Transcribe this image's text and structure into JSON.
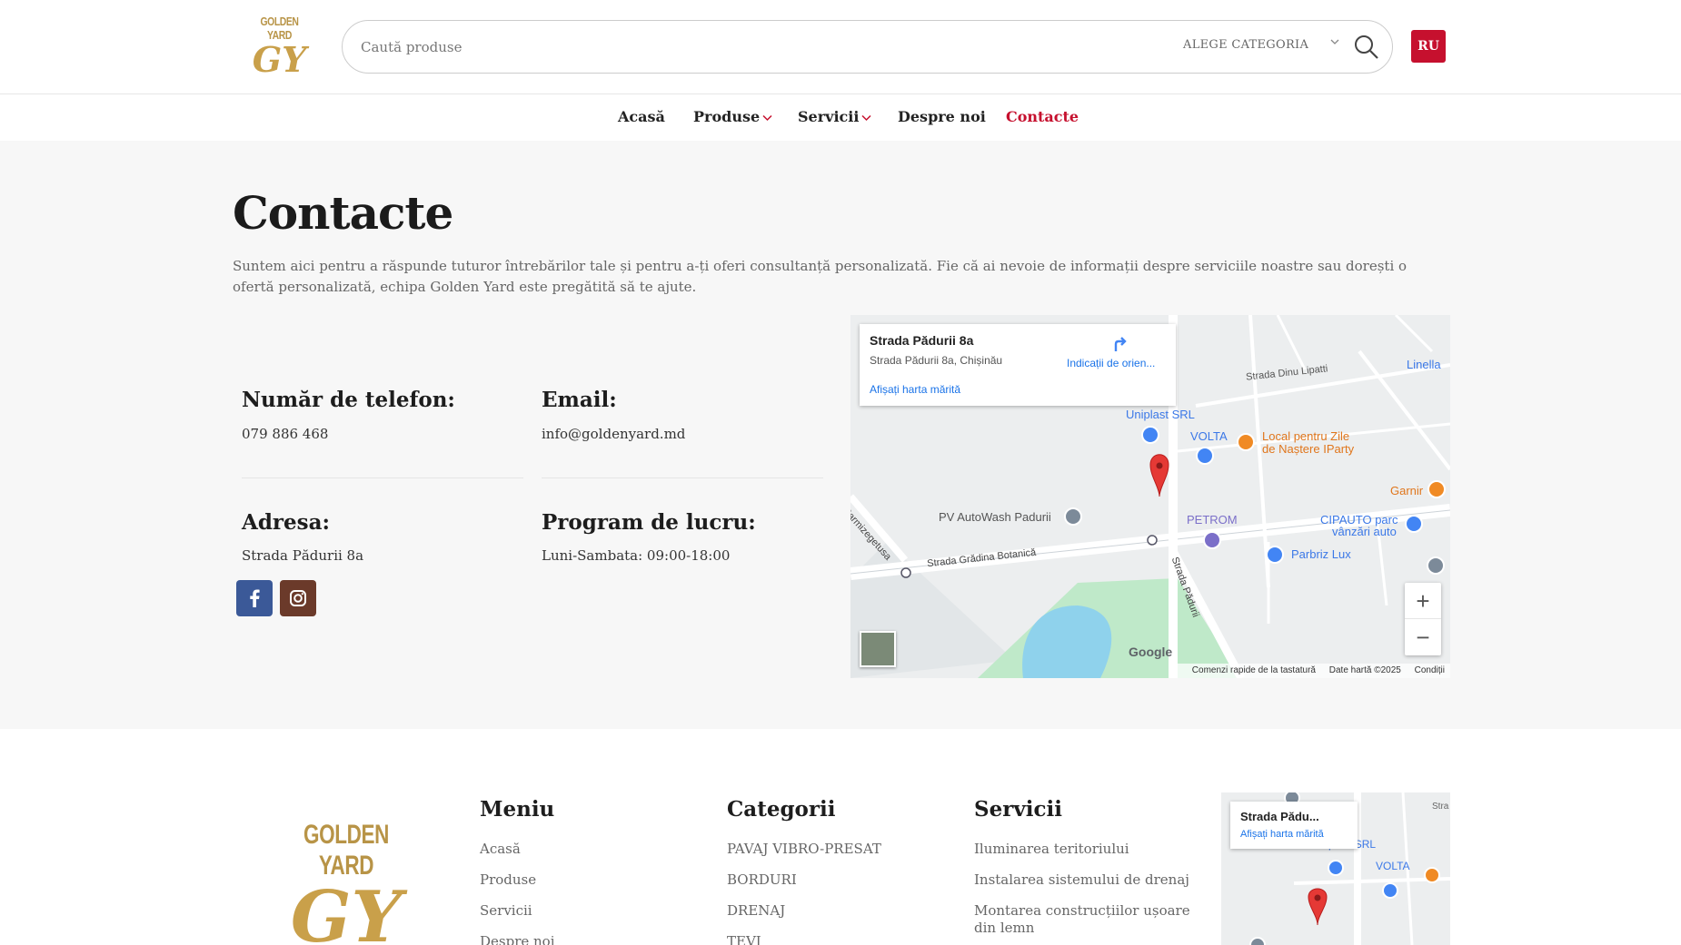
{
  "header": {
    "logo_text": "GOLDEN YARD",
    "logo_mark": "GY",
    "search_placeholder": "Caută produse",
    "category_label": "ALEGE CATEGORIA",
    "lang": "RU"
  },
  "nav": {
    "items": [
      {
        "label": "Acasă"
      },
      {
        "label": "Produse"
      },
      {
        "label": "Servicii"
      },
      {
        "label": "Despre noi"
      },
      {
        "label": "Contacte"
      }
    ]
  },
  "contact": {
    "title": "Contacte",
    "intro": "Suntem aici pentru a răspunde tuturor întrebărilor tale și pentru a-ți oferi consultanță personalizată. Fie că ai nevoie de informații despre serviciile noastre sau dorești o ofertă personalizată, echipa Golden Yard este pregătită să te ajute.",
    "phone_label": "Număr de telefon:",
    "phone_value": "079 886 468",
    "email_label": "Email:",
    "email_value": "info@goldenyard.md",
    "address_label": "Adresa:",
    "address_value": "Strada Pădurii 8a",
    "hours_label": "Program de lucru:",
    "hours_value": "Luni-Sambata: 09:00-18:00"
  },
  "social": {
    "facebook_color": "#3b5998",
    "instagram_color": "#6b3a2a"
  },
  "map": {
    "card_title": "Strada Pădurii 8a",
    "card_address": "Strada Pădurii 8a, Chișinău",
    "directions": "Indicații de orien...",
    "larger_map": "Afișați harta mărită",
    "labels": {
      "uniplast": "Uniplast SRL",
      "volta": "VOLTA",
      "local": "Local pentru Zile",
      "local2": "de Naștere IParty",
      "dinu": "Strada Dinu Lipatti",
      "linella": "Linella",
      "garnir": "Garnir",
      "pv": "PV AutoWash Padurii",
      "petrom": "PETROM",
      "cipauto": "CIPAUTO parc",
      "cipauto2": "vânzări auto",
      "parbriz": "Parbriz Lux",
      "sarmi": "Sarmizegetusa",
      "gradina": "Strada Grădina Botanică",
      "padurii": "Strada Pădurii",
      "google": "Google"
    },
    "footer_shortcuts": "Comenzi rapide de la tastatură",
    "footer_data": "Date hartă ©2025",
    "footer_terms": "Condiții",
    "zoom_in": "+",
    "zoom_out": "−"
  },
  "footer": {
    "logo_text": "GOLDEN YARD",
    "logo_mark": "GY",
    "menu_title": "Meniu",
    "menu": [
      "Acasă",
      "Produse",
      "Servicii",
      "Despre noi"
    ],
    "categories_title": "Categorii",
    "categories": [
      "PAVAJ VIBRO-PRESAT",
      "BORDURI",
      "DRENAJ",
      "ȚEVI"
    ],
    "services_title": "Servicii",
    "services": [
      "Iluminarea teritoriului",
      "Instalarea sistemului de drenaj",
      "Montarea construcțiilor ușoare din lemn"
    ],
    "map_card_title": "Strada Pădu...",
    "map_card_link": "Afișați harta mărită",
    "map_labels": {
      "uniplast": "Uniplast SRL",
      "volta": "VOLTA",
      "stra": "Stra"
    }
  }
}
